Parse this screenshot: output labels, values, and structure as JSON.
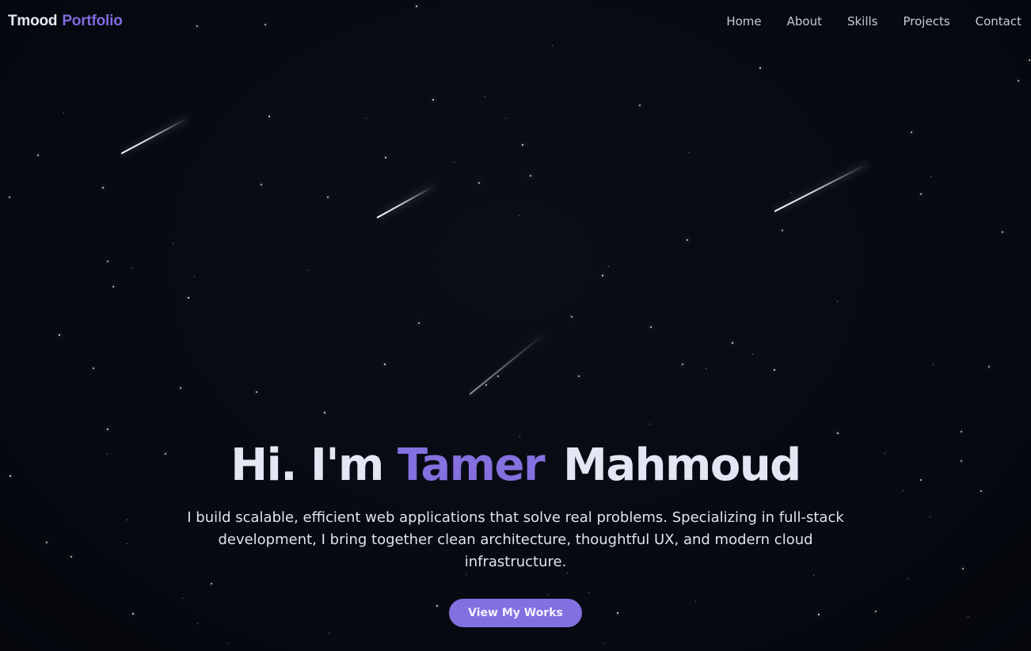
{
  "header": {
    "brand_first": "Tmood",
    "brand_second": "Portfolio",
    "nav": [
      {
        "label": "Home"
      },
      {
        "label": "About"
      },
      {
        "label": "Skills"
      },
      {
        "label": "Projects"
      },
      {
        "label": "Contact"
      }
    ]
  },
  "hero": {
    "greeting": "Hi. I'm",
    "first_name": "Tamer",
    "last_name": "Mahmoud",
    "description": "I build scalable, efficient web applications that solve real problems. Specializing in full-stack development, I bring together clean architecture, thoughtful UX, and modern cloud infrastructure.",
    "cta_label": "View My Works"
  },
  "colors": {
    "background": "#060912",
    "accent": "#8270e0",
    "text": "#e3e7f3",
    "nav_text": "#c7cbd6"
  }
}
